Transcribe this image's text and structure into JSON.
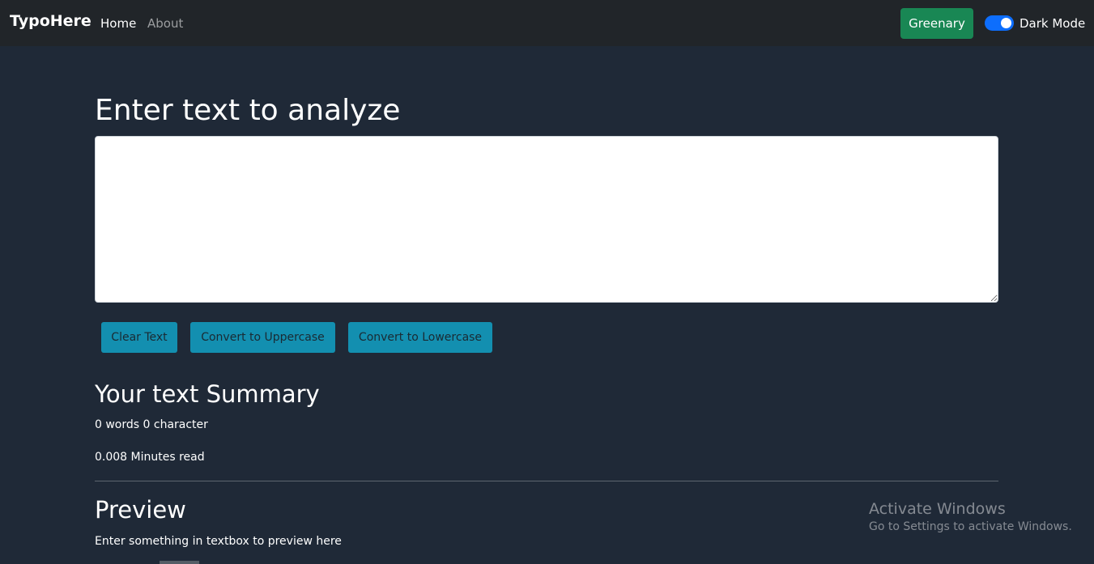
{
  "navbar": {
    "brand": "TypoHere",
    "links": [
      {
        "label": "Home",
        "active": true
      },
      {
        "label": "About",
        "active": false
      }
    ],
    "theme_button": "Greenary",
    "dark_mode_label": "Dark Mode",
    "dark_mode_on": true
  },
  "main": {
    "heading": "Enter text to analyze",
    "textarea_value": "",
    "buttons": {
      "clear": "Clear Text",
      "upper": "Convert to Uppercase",
      "lower": "Convert to Lowercase"
    }
  },
  "summary": {
    "heading": "Your text Summary",
    "words_line": "0 words 0 character",
    "read_line": "0.008 Minutes read"
  },
  "preview": {
    "heading": "Preview",
    "text": "Enter something in textbox to preview here"
  },
  "watermark": {
    "title": "Activate Windows",
    "subtitle": "Go to Settings to activate Windows."
  },
  "colors": {
    "background": "#1f2937",
    "navbar": "#212529",
    "greenary": "#198754",
    "toggle": "#0d6efd",
    "action_button": "#138fb0"
  }
}
